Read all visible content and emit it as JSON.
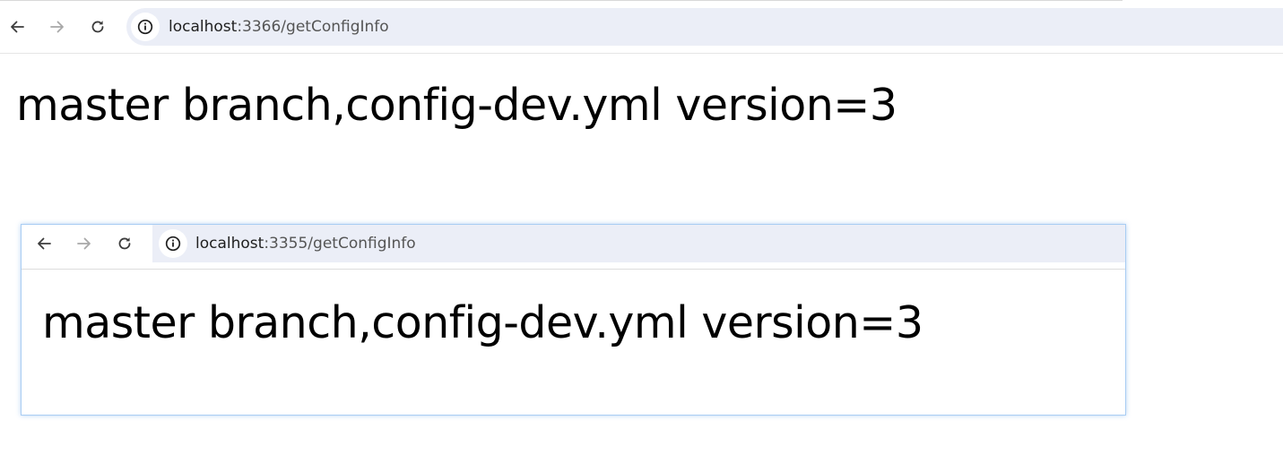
{
  "top_window": {
    "nav": {
      "back_icon": "arrow-left-icon",
      "forward_icon": "arrow-right-icon",
      "reload_icon": "reload-icon",
      "info_icon": "info-circle-icon"
    },
    "address": {
      "host": "localhost",
      "rest": ":3366/getConfigInfo"
    },
    "content": {
      "text": "master branch,config-dev.yml version=3"
    }
  },
  "inner_window": {
    "nav": {
      "back_icon": "arrow-left-icon",
      "forward_icon": "arrow-right-icon",
      "reload_icon": "reload-icon",
      "info_icon": "info-circle-icon"
    },
    "address": {
      "host": "localhost",
      "rest": ":3355/getConfigInfo"
    },
    "content": {
      "text": "master branch,config-dev.yml version=3"
    }
  },
  "colors": {
    "omnibox": "#ebeef7",
    "icon_active": "#3c3c3c",
    "icon_disabled": "#a8a8a8",
    "inner_window_border": "#a9cdf3"
  }
}
